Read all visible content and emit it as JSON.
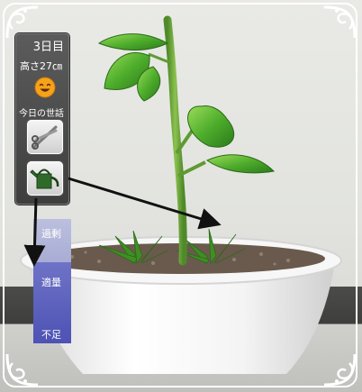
{
  "status": {
    "day": "3日目",
    "height": "高さ27㎝",
    "mood_icon": "smiling-face-icon",
    "care_label": "今日の世話"
  },
  "tools": [
    {
      "name": "scissors",
      "icon": "scissors-icon"
    },
    {
      "name": "watering-can",
      "icon": "watering-can-icon"
    }
  ],
  "water_gauge": {
    "labels": {
      "over": "過剰",
      "good": "適量",
      "less": "不足"
    },
    "level": 0.65
  },
  "colors": {
    "gauge_fill": "#5a5fbd",
    "gauge_bg": "#c0c3e6",
    "leaf": "#3f9a2a",
    "pot": "#f2f2f2"
  }
}
